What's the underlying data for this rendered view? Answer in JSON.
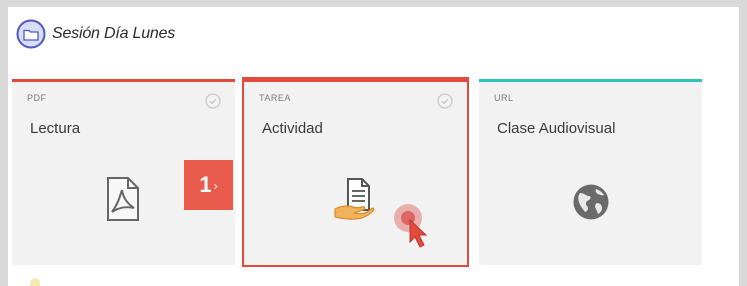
{
  "header": {
    "title": "Sesión Día Lunes",
    "icon": "folder-icon"
  },
  "cards": [
    {
      "type": "PDF",
      "title": "Lectura",
      "accent": "#e24b3c",
      "icon": "pdf-icon"
    },
    {
      "type": "TAREA",
      "title": "Actividad",
      "accent": "#e24b3c",
      "icon": "assignment-hand-icon",
      "selected": true
    },
    {
      "type": "URL",
      "title": "Clase Audiovisual",
      "accent": "#2fbfbf",
      "icon": "globe-icon"
    }
  ],
  "step": {
    "number": "1",
    "arrow": "›"
  },
  "colors": {
    "background": "#ffffff",
    "card": "#f2f2f2",
    "highlight": "#e24b3c",
    "teal": "#2fbfbf"
  }
}
